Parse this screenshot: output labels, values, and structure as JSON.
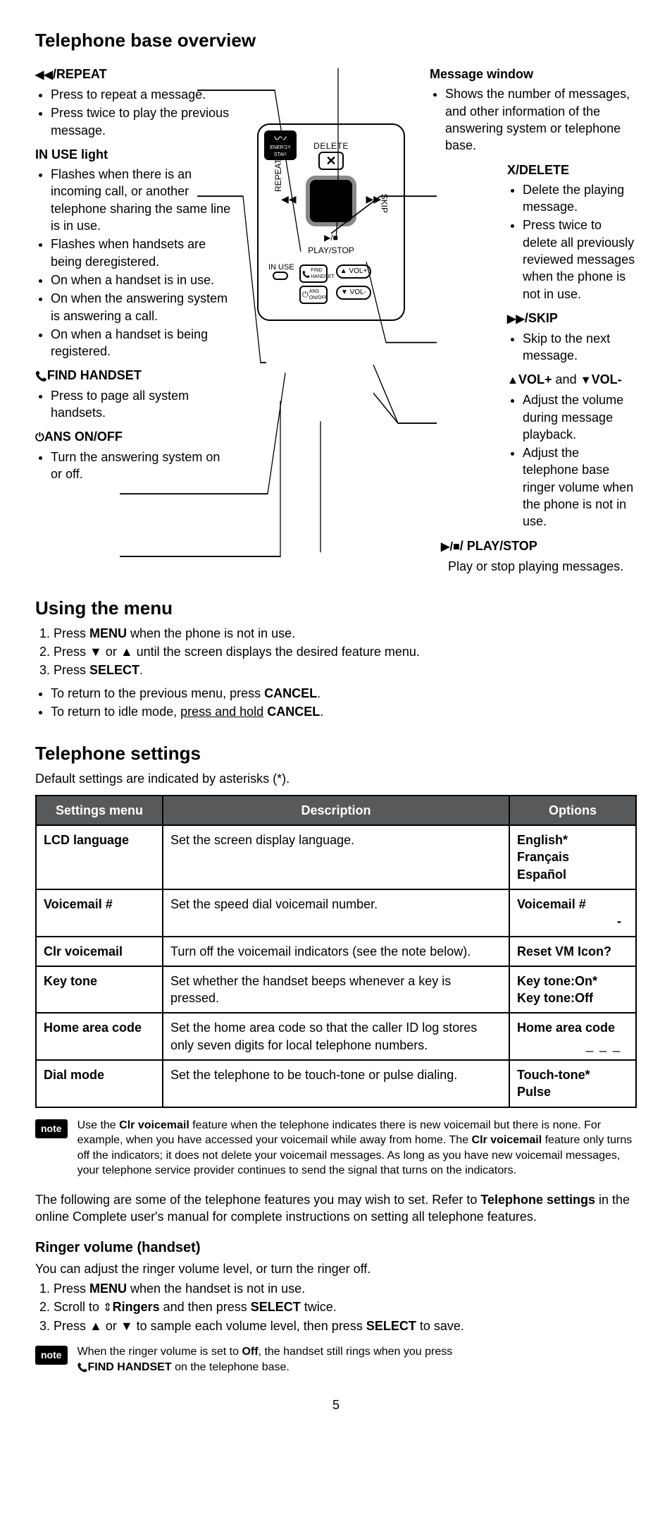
{
  "section1": {
    "title": "Telephone base overview",
    "left": {
      "repeat": {
        "head": "/REPEAT",
        "icon": "◀◀",
        "items": [
          "Press to repeat a message.",
          "Press twice to play the previous message."
        ]
      },
      "inuse": {
        "head": "IN USE light",
        "items": [
          "Flashes when there is an incoming call, or another telephone sharing the same line is in use.",
          "Flashes when handsets are being deregistered.",
          "On when a handset is in use.",
          "On when the answering system is answering a call.",
          "On when a handset is being registered."
        ]
      },
      "find": {
        "head": "FIND HANDSET",
        "icon": "📞",
        "items": [
          "Press to page all system handsets."
        ]
      },
      "ans": {
        "head": "ANS ON/OFF",
        "icon": "⏻",
        "items": [
          "Turn the answering system on or off."
        ]
      }
    },
    "right": {
      "msgwin": {
        "head": "Message window",
        "items": [
          "Shows the number of messages, and other information of the answering system or telephone base."
        ]
      },
      "xdelete": {
        "head": "X/DELETE",
        "items": [
          "Delete the playing message.",
          "Press twice to delete all   previously reviewed messages when the phone is not in use."
        ]
      },
      "skip": {
        "head": "/SKIP",
        "icon": "▶▶",
        "items": [
          "Skip to the next message."
        ]
      },
      "vol": {
        "head_pre": "VOL+ ",
        "head_mid": "and ",
        "head_post": "VOL-",
        "icon_up": "▲",
        "icon_down": "▼",
        "items": [
          "Adjust the volume during message playback.",
          "Adjust the telephone base ringer volume when the phone is not in use."
        ]
      },
      "playstop": {
        "head": "/ PLAY/STOP",
        "icon": "▶/■",
        "text": "Play or stop playing messages."
      }
    },
    "diagram": {
      "energy_star": "ENERGY STAR",
      "delete": "DELETE",
      "x": "✕",
      "repeat": "REPEAT",
      "skip": "SKIP",
      "rew": "◀◀",
      "fwd": "▶▶",
      "ps_icon": "▶/■",
      "playstop": "PLAY/STOP",
      "inuse": "IN USE",
      "find_pre": "FIND",
      "find_post": "HANDSET",
      "ans_pre": "ANS",
      "ans_post": "ON/OFF",
      "volp": "▲ VOL+",
      "volm": "▼ VOL-"
    }
  },
  "section2": {
    "title": "Using the menu",
    "steps": [
      {
        "pre": "Press ",
        "b": "MENU",
        "post": " when the phone is not in use."
      },
      {
        "pre": "Press ▼ or ▲ until the screen displays the desired feature menu.",
        "b": "",
        "post": ""
      },
      {
        "pre": "Press ",
        "b": "SELECT",
        "post": "."
      }
    ],
    "bullets": [
      {
        "pre": "To return to the previous menu, press ",
        "b": "CANCEL",
        "post": "."
      },
      {
        "pre": "To return to idle mode, ",
        "u": "press and hold",
        "post_b": " CANCEL",
        "post": "."
      }
    ]
  },
  "section3": {
    "title": "Telephone settings",
    "subtitle": "Default settings are indicated by asterisks (*).",
    "headers": {
      "c1": "Settings menu",
      "c2": "Description",
      "c3": "Options"
    },
    "rows": [
      {
        "c1": "LCD language",
        "c2": "Set the screen display language.",
        "c3": [
          "English*",
          "Français",
          "Español"
        ]
      },
      {
        "c1": "Voicemail #",
        "c2": "Set the speed dial voicemail number.",
        "c3": [
          "Voicemail #"
        ],
        "c3_right": "-"
      },
      {
        "c1": "Clr voicemail",
        "c2": "Turn off the voicemail indicators (see the note below).",
        "c3": [
          "Reset VM Icon?"
        ]
      },
      {
        "c1": "Key tone",
        "c2": "Set whether the handset beeps whenever a key is pressed.",
        "c3": [
          "Key tone:On*",
          "Key tone:Off"
        ]
      },
      {
        "c1": "Home area code",
        "c2": "Set the home area code so that the caller ID log stores only seven digits for local telephone numbers.",
        "c3": [
          "Home area code"
        ],
        "c3_dashes": "_ _ _"
      },
      {
        "c1": "Dial mode",
        "c2": "Set the telephone to be touch-tone or pulse dialing.",
        "c3": [
          "Touch-tone*",
          "Pulse"
        ]
      }
    ],
    "note_label": "note",
    "note": {
      "pre": "Use the ",
      "b1": "Clr voicemail",
      "mid1": " feature when the telephone indicates there is new voicemail but there is none. For example, when you have accessed your voicemail while away from home. The ",
      "b2": "Clr voicemail",
      "mid2": " feature only turns off the indicators; it does not delete your voicemail messages. As long as you have new voicemail messages, your telephone service provider continues to send the signal that turns on the indicators."
    },
    "following": {
      "pre": "The following are some of the telephone features you may wish to set. Refer to ",
      "b": "Telephone settings",
      "post": " in the online Complete user's manual for complete instructions on setting all telephone features."
    }
  },
  "section4": {
    "title": "Ringer volume (handset)",
    "intro": "You can adjust the ringer volume level, or turn the ringer off.",
    "steps": [
      {
        "pre": "Press ",
        "b": "MENU",
        "post": " when the handset is not in use."
      },
      {
        "pre": "Scroll to ",
        "icon": "⇕",
        "b": "Ringers",
        "mid": " and then press ",
        "b2": "SELECT",
        "post": " twice."
      },
      {
        "pre": "Press ▲ or ▼ to sample each volume level, then press ",
        "b": "SELECT",
        "post": " to save."
      }
    ],
    "note_label": "note",
    "note": {
      "pre": "When the ringer volume is set to ",
      "b1": "Off",
      "mid": ", the handset still rings when you press ",
      "b2": "FIND HANDSET",
      "post": " on the telephone base."
    }
  },
  "page_num": "5"
}
